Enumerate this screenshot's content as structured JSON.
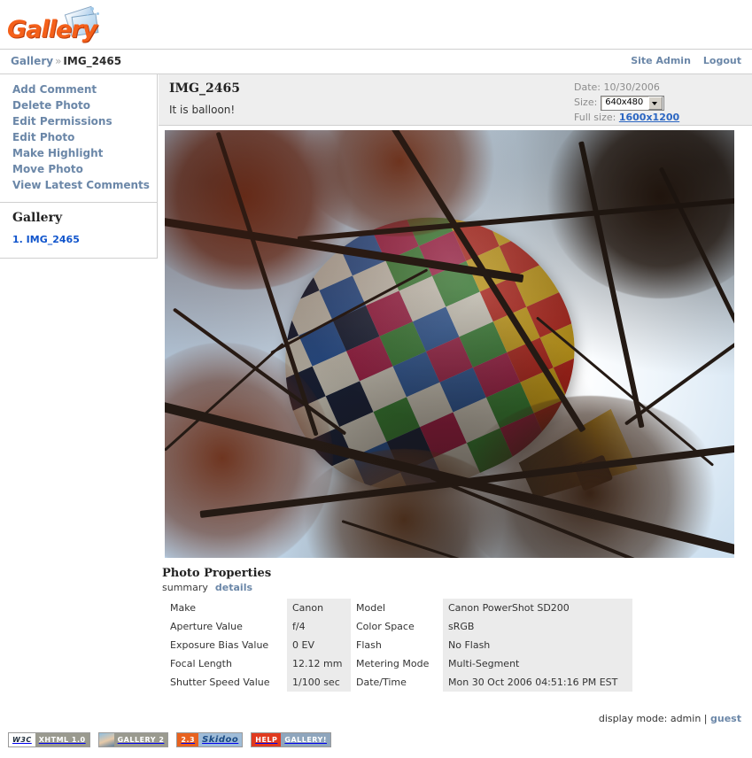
{
  "header": {
    "logo_text": "Gallery",
    "logo_icon": "gallery-photo-sparkle-logo"
  },
  "breadcrumb": {
    "root": "Gallery",
    "separator": "»",
    "current": "IMG_2465"
  },
  "topnav": {
    "site_admin": "Site Admin",
    "logout": "Logout"
  },
  "sidebar": {
    "actions": [
      {
        "label": "Add Comment"
      },
      {
        "label": "Delete Photo"
      },
      {
        "label": "Edit Permissions"
      },
      {
        "label": "Edit Photo"
      },
      {
        "label": "Make Highlight"
      },
      {
        "label": "Move Photo"
      },
      {
        "label": "View Latest Comments"
      }
    ],
    "album": {
      "title": "Gallery",
      "items": [
        {
          "label": "1. IMG_2465"
        }
      ]
    }
  },
  "item": {
    "title": "IMG_2465",
    "description": "It is balloon!",
    "date_label": "Date:",
    "date_value": "10/30/2006",
    "size_label": "Size:",
    "size_value": "640x480",
    "size_options": [
      "640x480"
    ],
    "fullsize_label": "Full size:",
    "fullsize_value": "1600x1200",
    "photo_alt": "hot air balloon seen through autumn tree branches"
  },
  "properties": {
    "title": "Photo Properties",
    "tabs": {
      "summary": "summary",
      "details": "details"
    },
    "rows": [
      {
        "k1": "Make",
        "v1": "Canon",
        "k2": "Model",
        "v2": "Canon PowerShot SD200"
      },
      {
        "k1": "Aperture Value",
        "v1": "f/4",
        "k2": "Color Space",
        "v2": "sRGB"
      },
      {
        "k1": "Exposure Bias Value",
        "v1": "0 EV",
        "k2": "Flash",
        "v2": "No Flash"
      },
      {
        "k1": "Focal Length",
        "v1": "12.12 mm",
        "k2": "Metering Mode",
        "v2": "Multi-Segment"
      },
      {
        "k1": "Shutter Speed Value",
        "v1": "1/100 sec",
        "k2": "Date/Time",
        "v2": "Mon 30 Oct 2006 04:51:16 PM EST"
      }
    ]
  },
  "footer": {
    "display_mode_label": "display mode:",
    "display_mode_current": "admin",
    "display_mode_separator": "|",
    "display_mode_other": "guest",
    "badges": [
      {
        "left": "W3C",
        "right": "XHTML 1.0"
      },
      {
        "left": "",
        "right": "GALLERY 2"
      },
      {
        "left": "2.3",
        "right": "Skidoo"
      },
      {
        "left": "HELP",
        "right": "GALLERY!"
      }
    ]
  },
  "colors": {
    "link": "#6b87a8",
    "album_link": "#1155cc",
    "accent_orange": "#f4601a",
    "header_bg": "#eeeeee",
    "value_cell_bg": "#ebebeb",
    "border": "#cfcfcf"
  }
}
